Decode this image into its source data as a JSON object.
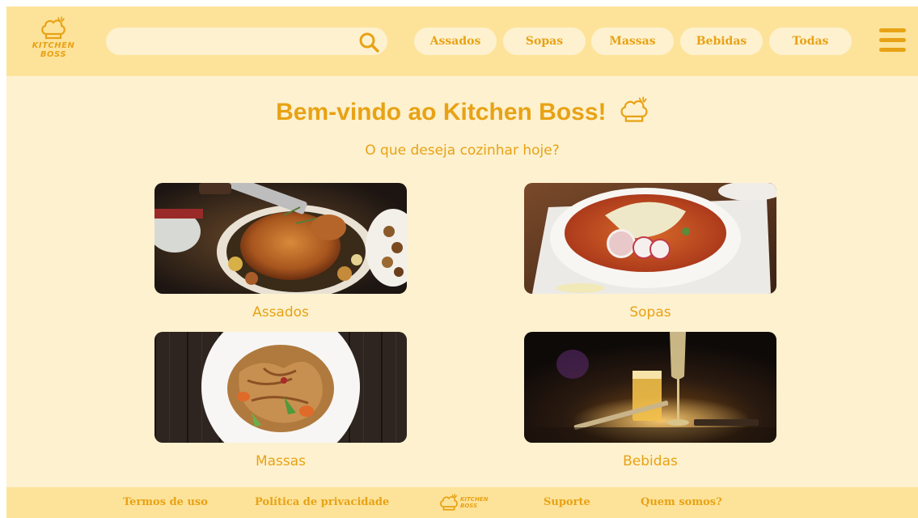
{
  "header": {
    "logo_line1": "KITCHEN",
    "logo_line2": "BOSS",
    "search": {
      "value": "",
      "placeholder": "",
      "icon": "search-icon"
    },
    "categories": [
      "Assados",
      "Sopas",
      "Massas",
      "Bebidas",
      "Todas"
    ],
    "menu_icon": "hamburger-menu-icon"
  },
  "main": {
    "welcome": "Bem-vindo ao Kitchen Boss!",
    "subtitle": "O que deseja cozinhar hoje?",
    "cards": [
      {
        "label": "Assados"
      },
      {
        "label": "Sopas"
      },
      {
        "label": "Massas"
      },
      {
        "label": "Bebidas"
      }
    ]
  },
  "footer": {
    "links": [
      "Termos de uso",
      "Política de privacidade",
      "Suporte",
      "Quem somos?"
    ],
    "logo_line1": "KITCHEN",
    "logo_line2": "BOSS"
  },
  "colors": {
    "accent": "#e8a215",
    "header_bg": "#fde39a",
    "page_bg": "#fdf1cf"
  }
}
